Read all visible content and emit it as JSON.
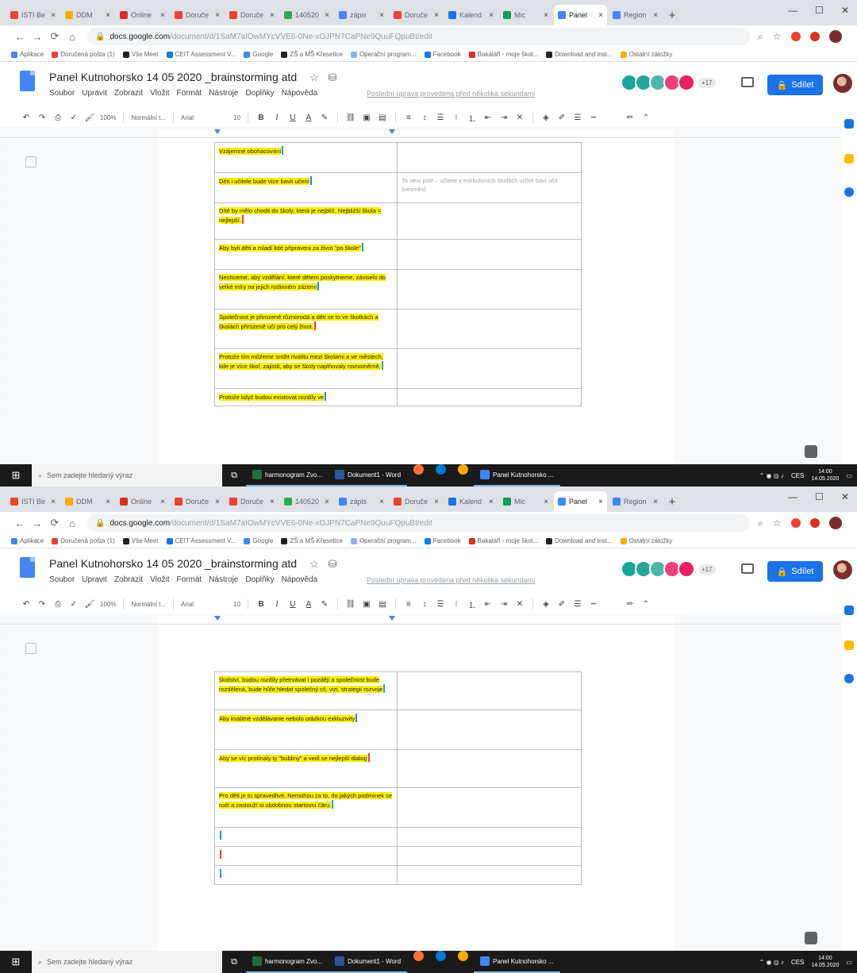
{
  "browser": {
    "tabs": [
      {
        "label": "ISTI Be",
        "color": "#ea4335"
      },
      {
        "label": "DDM",
        "color": "#f9ab00"
      },
      {
        "label": "Online",
        "color": "#d93025"
      },
      {
        "label": "Doruče",
        "color": "#ea4335"
      },
      {
        "label": "Doruče",
        "color": "#ea4335"
      },
      {
        "label": "140520",
        "color": "#34a853"
      },
      {
        "label": "zápis",
        "color": "#4285f4"
      },
      {
        "label": "Doruče",
        "color": "#ea4335"
      },
      {
        "label": "Kalend",
        "color": "#1a73e8"
      },
      {
        "label": "Mic",
        "color": "#0f9d58"
      },
      {
        "label": "Panel",
        "color": "#4285f4",
        "active": true
      },
      {
        "label": "Region",
        "color": "#4285f4"
      }
    ],
    "url_host": "docs.google.com",
    "url_path": "/document/d/1SaM7aIOwMYcVVE6-0Ne-xOJPN7CaPNe9QuuFQpuBt/edit",
    "bookmarks": [
      {
        "label": "Aplikace",
        "color": "#4285f4"
      },
      {
        "label": "Doručená pošta (1)",
        "color": "#ea4335"
      },
      {
        "label": "Vše Meet",
        "color": "#202124"
      },
      {
        "label": "CEIT Assessment V...",
        "color": "#1a73e8"
      },
      {
        "label": "Google",
        "color": "#4285f4"
      },
      {
        "label": "ZŠ a MŠ Křesetice",
        "color": "#202124"
      },
      {
        "label": "Operační program...",
        "color": "#8ab4f8"
      },
      {
        "label": "Facebook",
        "color": "#1877f2"
      },
      {
        "label": "Bakaláři - moje škol...",
        "color": "#d93025"
      },
      {
        "label": "Download and inst...",
        "color": "#202124"
      },
      {
        "label": "Ostatní záložky",
        "color": "#f9ab00"
      }
    ]
  },
  "doc": {
    "title": "Panel Kutnohorsko 14 05 2020 _brainstorming atd",
    "menu": [
      "Soubor",
      "Upravit",
      "Zobrazit",
      "Vložit",
      "Formát",
      "Nástroje",
      "Doplňky",
      "Nápověda"
    ],
    "last_edit": "Poslední úprava provedena před několika sekundami",
    "collaborators_more": "+17",
    "share_label": "Sdílet",
    "zoom": "100%",
    "style": "Normální t...",
    "font": "Arial",
    "font_size": "10"
  },
  "collab_colors": [
    "#1aa59a",
    "#26a69a",
    "#4db6ac",
    "#ec407a",
    "#e91e63"
  ],
  "table_top": {
    "rows": [
      {
        "text": "Vzájemné obohacování",
        "note": ""
      },
      {
        "text": "Děti i učitele bude více bavit učení",
        "note": "To není jisté – učitele v exkluzivních školách určitě baví učit (vesměs)"
      },
      {
        "text": "Dítě by mělo chodit do školy, která je nejblíž. Nejbližší škola = nejlepší.",
        "note": ""
      },
      {
        "text": "Aby byli děti a mladí lidé připraveni za život \"po škole\"",
        "note": ""
      },
      {
        "text": "Nechceme, aby vzdělání, které dětem poskytneme, záviselo do velké míry na jejich rodinném zázemí",
        "note": ""
      },
      {
        "text": "Společnost je přirozeně různorodá a děti se to ve školkách a školách přirozeně učí pro celý život.",
        "note": ""
      },
      {
        "text": "Protože tím můžeme snížit rivalitu mezi školami a ve městech, kde je více škol, zajistit, aby se školy naplňovaly rovnoměrně.",
        "note": ""
      },
      {
        "text": "Protože když budou existovat rozdíly ve",
        "note": ""
      }
    ]
  },
  "table_bottom": {
    "rows": [
      {
        "text": "školství, budou rozdíly přetrvávat i později a společnost bude rozdělená, bude hůře hledat společný cíl, vizi, strategii rozvoje",
        "note": ""
      },
      {
        "text": "Aby kvalitně vzdělávanie nebolo otázkou exkluzivity",
        "note": ""
      },
      {
        "text": "Aby se víc protínaly ty \"bubliny\" a vedl se nejlepší dialog",
        "note": ""
      },
      {
        "text": "Pro děti je to spravedlivé. Nemohou za to, do jakých podmínek se rodí a zaslouží si obdobnou startovní čáru.",
        "note": ""
      },
      {
        "text": "",
        "note": ""
      },
      {
        "text": "",
        "note": ""
      },
      {
        "text": "",
        "note": ""
      }
    ]
  },
  "taskbar": {
    "search_placeholder": "Sem zadejte hledaný výraz",
    "apps": [
      {
        "label": "harmonogram Zvo...",
        "color": "#1d6f42"
      },
      {
        "label": "Dokument1 - Word",
        "color": "#2b579a"
      },
      {
        "label": "Panel Kutnohorsko ...",
        "color": "#4285f4"
      }
    ],
    "lang": "CES",
    "time": "14:00",
    "date": "14.05.2020"
  }
}
